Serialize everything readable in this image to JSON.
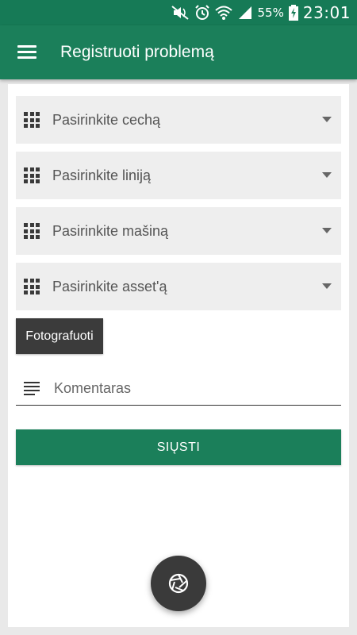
{
  "status_bar": {
    "battery": "55%",
    "time": "23:01",
    "icons": [
      "mute-icon",
      "alarm-icon",
      "wifi-icon",
      "signal-icon",
      "battery-charging-icon"
    ]
  },
  "app_bar": {
    "title": "Registruoti problemą",
    "menu_icon": "hamburger-menu-icon"
  },
  "form": {
    "selects": [
      {
        "label": "Pasirinkite cechą",
        "icon": "grid-icon"
      },
      {
        "label": "Pasirinkite liniją",
        "icon": "grid-icon"
      },
      {
        "label": "Pasirinkite mašiną",
        "icon": "grid-icon"
      },
      {
        "label": "Pasirinkite asset'ą",
        "icon": "grid-icon"
      }
    ],
    "photo_button": "Fotografuoti",
    "comment": {
      "placeholder": "Komentaras",
      "value": "",
      "icon": "notes-icon"
    },
    "send_button": "SIŲSTI"
  },
  "fab": {
    "icon": "camera-shutter-icon"
  },
  "colors": {
    "primary": "#1b7f5a",
    "status_bar": "#167a56",
    "dark_button": "#3b3b3b",
    "select_background": "#eeeeee",
    "page_background": "#e9e9e9"
  }
}
